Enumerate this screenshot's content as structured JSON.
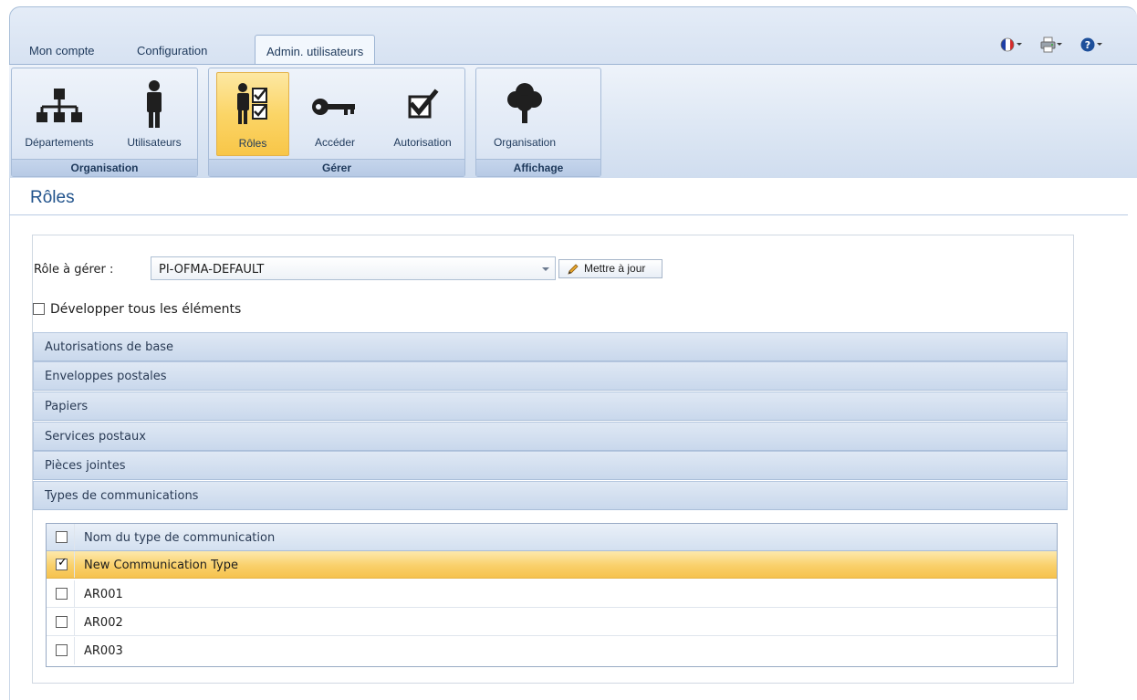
{
  "tabs": [
    {
      "label": "Mon compte",
      "active": false
    },
    {
      "label": "Configuration",
      "active": false
    },
    {
      "label": "Admin. utilisateurs",
      "active": true
    }
  ],
  "top_icons": [
    "language-flag-icon",
    "printer-icon",
    "help-icon"
  ],
  "ribbon": {
    "groups": [
      {
        "label": "Organisation",
        "buttons": [
          {
            "label": "Départements",
            "icon": "org-chart-icon"
          },
          {
            "label": "Utilisateurs",
            "icon": "user-icon"
          }
        ]
      },
      {
        "label": "Gérer",
        "buttons": [
          {
            "label": "Rôles",
            "icon": "roles-icon",
            "active": true
          },
          {
            "label": "Accéder",
            "icon": "key-icon"
          },
          {
            "label": "Autorisation",
            "icon": "checkbox-check-icon"
          }
        ]
      },
      {
        "label": "Affichage",
        "buttons": [
          {
            "label": "Organisation",
            "icon": "tree-icon"
          }
        ]
      }
    ]
  },
  "page": {
    "title": "Rôles"
  },
  "role": {
    "label": "Rôle à gérer :",
    "selected": "PI-OFMA-DEFAULT",
    "update_label": "Mettre à jour"
  },
  "expand_all": {
    "label": "Développer tous les éléments",
    "checked": false
  },
  "sections": [
    {
      "label": "Autorisations de base"
    },
    {
      "label": "Enveloppes postales"
    },
    {
      "label": "Papiers"
    },
    {
      "label": "Services postaux"
    },
    {
      "label": "Pièces jointes"
    },
    {
      "label": "Types de communications",
      "expanded": true
    }
  ],
  "grid": {
    "header": "Nom du type de communication",
    "rows": [
      {
        "name": "New Communication Type",
        "checked": true,
        "selected": true
      },
      {
        "name": "AR001",
        "checked": false
      },
      {
        "name": "AR002",
        "checked": false
      },
      {
        "name": "AR003",
        "checked": false
      }
    ]
  },
  "colors": {
    "accent": "#21538c",
    "selected_row": "#f9d06a",
    "ribbon": "#d4e0f1"
  }
}
